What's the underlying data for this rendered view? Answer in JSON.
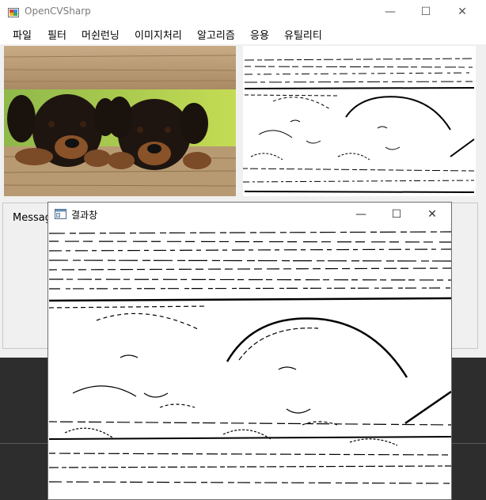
{
  "window": {
    "title": "OpenCVSharp",
    "icon": "opencvsharp-app-icon",
    "controls": {
      "minimize": "—",
      "maximize": "☐",
      "close": "✕"
    }
  },
  "menu": {
    "items": [
      "파일",
      "필터",
      "머쉰런닝",
      "이미지처리",
      "알고리즘",
      "응용",
      "유틸리티"
    ]
  },
  "source_image": {
    "description_icon": "puppy-photo"
  },
  "edge_image": {
    "icon": "edge-detection-output"
  },
  "message": {
    "label": "Message"
  },
  "result_window": {
    "title": "결과창",
    "controls": {
      "minimize": "—",
      "maximize": "☐",
      "close": "✕"
    }
  }
}
